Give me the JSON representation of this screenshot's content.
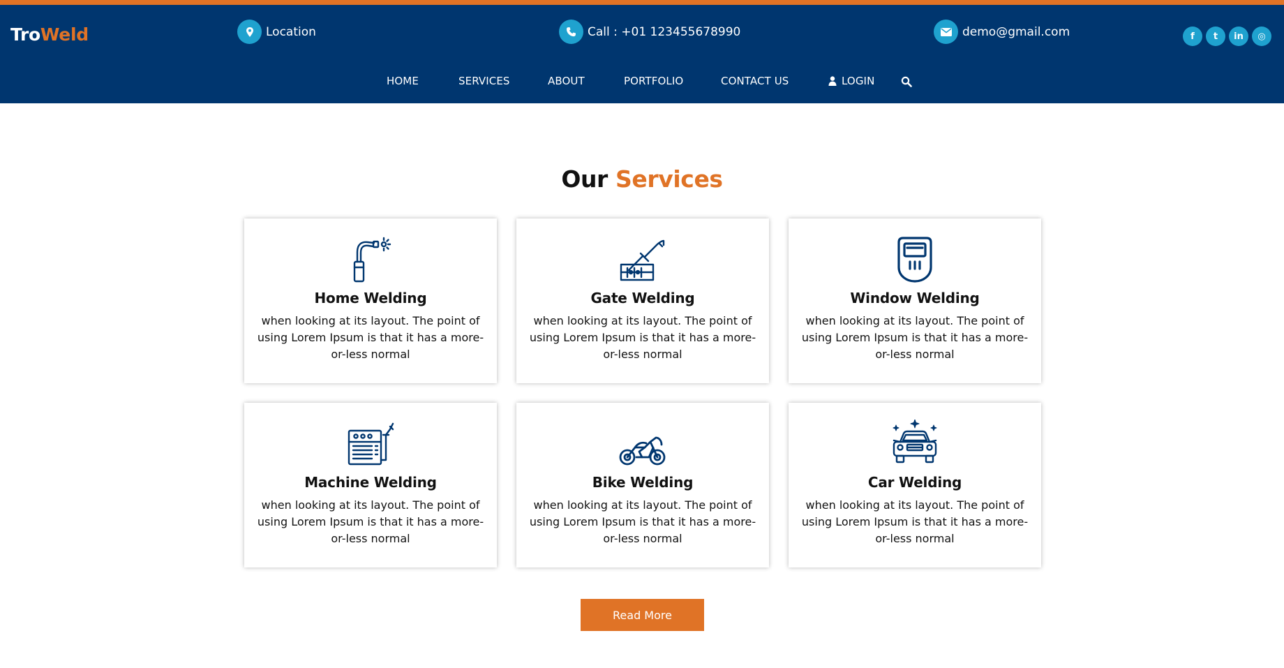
{
  "colors": {
    "navy": "#00366f",
    "accent": "#e07326",
    "icon_circle": "#1fa2cf",
    "text": "#111111"
  },
  "brand": {
    "part1": "Tro",
    "part2": "Weld"
  },
  "contacts": {
    "location": {
      "icon": "map-marker-icon",
      "text": "Location"
    },
    "call": {
      "icon": "phone-icon",
      "text": "Call : +01 123455678990"
    },
    "email": {
      "icon": "envelope-icon",
      "text": "demo@gmail.com"
    }
  },
  "socials": [
    {
      "icon": "facebook-icon",
      "glyph": "f"
    },
    {
      "icon": "twitter-icon",
      "glyph": "t"
    },
    {
      "icon": "linkedin-icon",
      "glyph": "in"
    },
    {
      "icon": "instagram-icon",
      "glyph": "◎"
    }
  ],
  "nav": {
    "home": "HOME",
    "services": "SERVICES",
    "about": "ABOUT",
    "portfolio": "PORTFOLIO",
    "contact": "CONTACT US",
    "login": "LOGIN",
    "search_icon": "search-icon",
    "login_icon": "user-icon"
  },
  "section": {
    "title_part1": "Our",
    "title_part2": "Services"
  },
  "services": [
    {
      "title": "Home Welding",
      "desc": "when looking at its layout. The point of using Lorem Ipsum is that it has a more-or-less normal",
      "icon": "welding-torch-icon"
    },
    {
      "title": "Gate Welding",
      "desc": "when looking at its layout. The point of using Lorem Ipsum is that it has a more-or-less normal",
      "icon": "welding-rod-icon"
    },
    {
      "title": "Window Welding",
      "desc": "when looking at its layout. The point of using Lorem Ipsum is that it has a more-or-less normal",
      "icon": "welding-mask-icon"
    },
    {
      "title": "Machine Welding",
      "desc": "when looking at its layout. The point of using Lorem Ipsum is that it has a more-or-less normal",
      "icon": "welding-machine-icon"
    },
    {
      "title": "Bike Welding",
      "desc": "when looking at its layout. The point of using Lorem Ipsum is that it has a more-or-less normal",
      "icon": "motorbike-icon"
    },
    {
      "title": "Car Welding",
      "desc": "when looking at its layout. The point of using Lorem Ipsum is that it has a more-or-less normal",
      "icon": "car-icon"
    }
  ],
  "read_more": "Read More"
}
